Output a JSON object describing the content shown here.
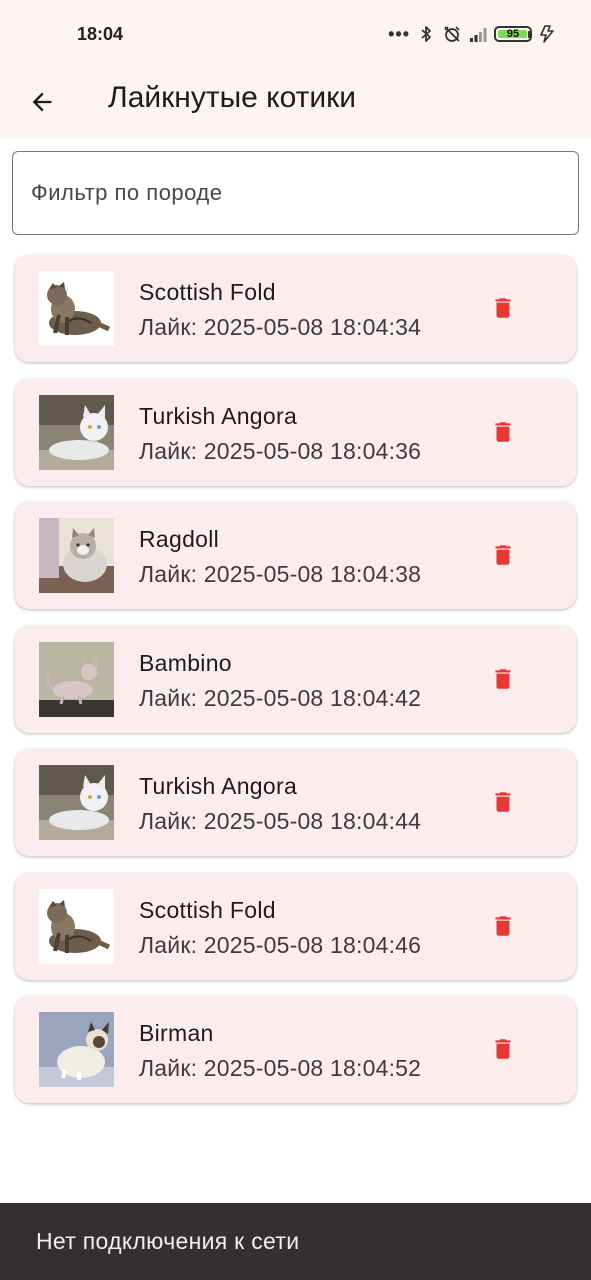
{
  "status_bar": {
    "time": "18:04",
    "battery_level": "95",
    "battery_fraction": 0.95,
    "icons": [
      "more-dots-icon",
      "bluetooth-icon",
      "alarm-off-icon",
      "signal-icon",
      "battery-icon",
      "charging-icon"
    ]
  },
  "app_bar": {
    "back_icon": "arrow-back-icon",
    "title": "Лайкнутые котики"
  },
  "filter": {
    "value": "",
    "placeholder": "Фильтр по породе"
  },
  "likes": [
    {
      "breed": "Scottish Fold",
      "liked": "Лайк: 2025-05-08 18:04:34",
      "photo": "scottish-fold"
    },
    {
      "breed": "Turkish Angora",
      "liked": "Лайк: 2025-05-08 18:04:36",
      "photo": "turkish-angora"
    },
    {
      "breed": "Ragdoll",
      "liked": "Лайк: 2025-05-08 18:04:38",
      "photo": "ragdoll"
    },
    {
      "breed": "Bambino",
      "liked": "Лайк: 2025-05-08 18:04:42",
      "photo": "bambino"
    },
    {
      "breed": "Turkish Angora",
      "liked": "Лайк: 2025-05-08 18:04:44",
      "photo": "turkish-angora"
    },
    {
      "breed": "Scottish Fold",
      "liked": "Лайк: 2025-05-08 18:04:46",
      "photo": "scottish-fold"
    },
    {
      "breed": "Birman",
      "liked": "Лайк: 2025-05-08 18:04:52",
      "photo": "birman"
    }
  ],
  "delete_icon": "trash-icon",
  "snackbar": {
    "message": "Нет подключения к сети"
  },
  "colors": {
    "app_bar_bg": "#fdf3f1",
    "card_bg": "#fdeced",
    "delete_red": "#e53935",
    "snackbar_bg": "#362f2f",
    "battery_green": "#7ed957"
  }
}
